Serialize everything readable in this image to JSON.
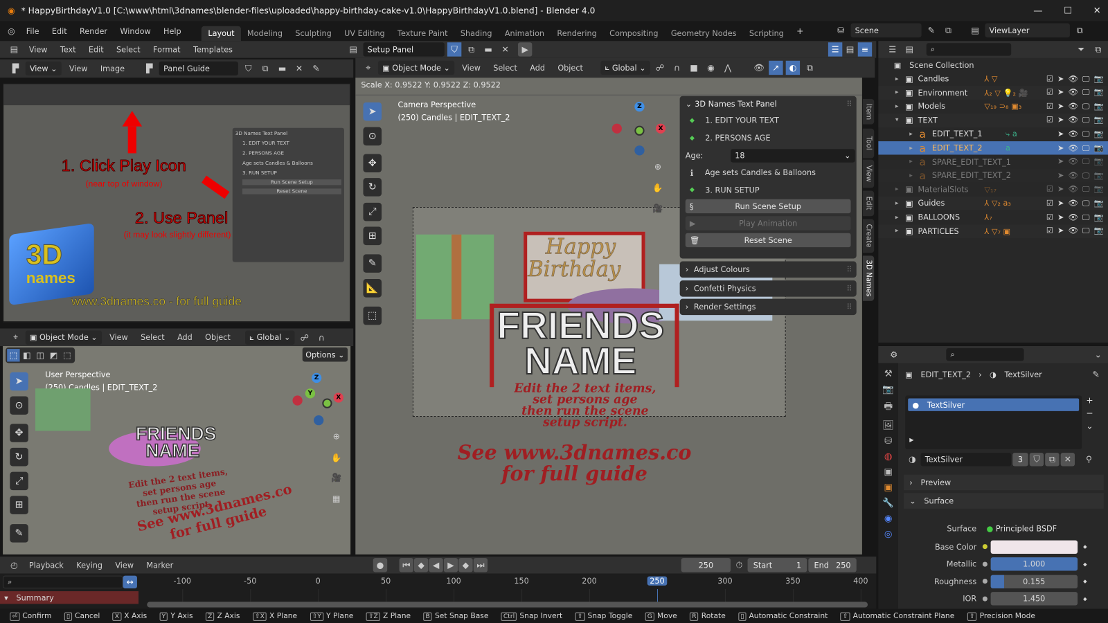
{
  "window": {
    "title": "* HappyBirthdayV1.0 [C:\\www\\html\\3dnames\\blender-files\\uploaded\\happy-birthday-cake-v1.0\\HappyBirthdayV1.0.blend] - Blender 4.0"
  },
  "menu": [
    "File",
    "Edit",
    "Render",
    "Window",
    "Help"
  ],
  "workspaces": [
    {
      "label": "Layout",
      "active": true
    },
    {
      "label": "Modeling"
    },
    {
      "label": "Sculpting"
    },
    {
      "label": "UV Editing"
    },
    {
      "label": "Texture Paint"
    },
    {
      "label": "Shading"
    },
    {
      "label": "Animation"
    },
    {
      "label": "Rendering"
    },
    {
      "label": "Compositing"
    },
    {
      "label": "Geometry Nodes"
    },
    {
      "label": "Scripting"
    }
  ],
  "scene": {
    "name": "Scene",
    "view_layer": "ViewLayer"
  },
  "text_editor": {
    "menus": [
      "View",
      "Text",
      "Edit",
      "Select",
      "Format",
      "Templates"
    ],
    "text_name": "Setup Panel"
  },
  "image_editor": {
    "view_dropdown": "View",
    "menus": [
      "View",
      "Image"
    ],
    "image_name": "Panel Guide"
  },
  "guide": {
    "step1": "1. Click Play Icon",
    "step1_sub": "(near top of window)",
    "step2": "2. Use Panel",
    "step2_sub": "(it may look slightly different)",
    "footer": "www.3dnames.co - for full guide",
    "logo": "3D names"
  },
  "viewport": {
    "mode": "Object Mode",
    "menus": [
      "View",
      "Select",
      "Add",
      "Object"
    ],
    "orientation": "Global",
    "status": "Scale X: 0.9522   Y: 0.9522   Z: 0.9522",
    "perspective": "Camera Perspective",
    "info": "(250) Candles | EDIT_TEXT_2",
    "scene_text": {
      "happy": "Happy",
      "birthday": "Birthday",
      "friends": "FRIENDS",
      "name": "NAME",
      "instructions": [
        "Edit the 2 text items,",
        "set persons age",
        "then run the scene",
        "setup script."
      ],
      "guide": [
        "See www.3dnames.co",
        "for full guide"
      ]
    }
  },
  "sidebar_tabs": [
    "Item",
    "Tool",
    "View",
    "Edit",
    "Create",
    "3D Names"
  ],
  "names_panel": {
    "title": "3D Names Text Panel",
    "step1": "1. EDIT YOUR TEXT",
    "step2": "2. PERSONS AGE",
    "age_label": "Age:",
    "age_value": "18",
    "info": "Age sets Candles & Balloons",
    "step3": "3. RUN SETUP",
    "run": "Run Scene Setup",
    "play": "Play Animation",
    "reset": "Reset Scene",
    "subpanels": [
      "Adjust Colours",
      "Confetti Physics",
      "Render Settings"
    ]
  },
  "viewport2": {
    "mode": "Object Mode",
    "menus": [
      "View",
      "Select",
      "Add",
      "Object"
    ],
    "orientation": "Global",
    "options": "Options",
    "perspective": "User Perspective",
    "info": "(250) Candles | EDIT_TEXT_2"
  },
  "outliner": {
    "root": "Scene Collection",
    "items": [
      {
        "name": "Candles",
        "depth": 0,
        "icons": "⅄ ▽",
        "exp": "▸",
        "check": true
      },
      {
        "name": "Environment",
        "depth": 0,
        "icons": "⅄₂ ▽ 💡₂ 🎥",
        "exp": "▸",
        "check": true
      },
      {
        "name": "Models",
        "depth": 0,
        "icons": "▽₁₉ ⊃₈ ▣₃",
        "exp": "▸",
        "check": true
      },
      {
        "name": "TEXT",
        "depth": 0,
        "icons": "",
        "exp": "▾",
        "check": true
      },
      {
        "name": "EDIT_TEXT_1",
        "depth": 1,
        "icons": "⤷ a",
        "exp": "▸",
        "check": false
      },
      {
        "name": "EDIT_TEXT_2",
        "depth": 1,
        "icons": "a",
        "exp": "▸",
        "check": false,
        "selected": true
      },
      {
        "name": "SPARE_EDIT_TEXT_1",
        "depth": 1,
        "icons": "",
        "exp": "▸",
        "check": false,
        "dim": true
      },
      {
        "name": "SPARE_EDIT_TEXT_2",
        "depth": 1,
        "icons": "",
        "exp": "▸",
        "check": false,
        "dim": true
      },
      {
        "name": "MaterialSlots",
        "depth": 0,
        "icons": "▽₁₇",
        "exp": "▸",
        "check": true,
        "dim": true
      },
      {
        "name": "Guides",
        "depth": 0,
        "icons": "⅄ ▽₂ a₃",
        "exp": "▸",
        "check": true
      },
      {
        "name": "BALLOONS",
        "depth": 0,
        "icons": "⅄₇",
        "exp": "▸",
        "check": true
      },
      {
        "name": "PARTICLES",
        "depth": 0,
        "icons": "⅄ ▽₇ ▣",
        "exp": "▸",
        "check": true
      }
    ]
  },
  "properties": {
    "object": "EDIT_TEXT_2",
    "material": "TextSilver",
    "slot": "TextSilver",
    "users": "3",
    "preview": "Preview",
    "surface_panel": "Surface",
    "surface_label": "Surface",
    "surface_value": "Principled BSDF",
    "fields": [
      {
        "label": "Base Color",
        "value": "",
        "color": "#f0e6ea"
      },
      {
        "label": "Metallic",
        "value": "1.000",
        "fill": 1.0
      },
      {
        "label": "Roughness",
        "value": "0.155",
        "fill": 0.155
      },
      {
        "label": "IOR",
        "value": "1.450",
        "fill": 0
      }
    ]
  },
  "timeline": {
    "menus": [
      "Playback",
      "Keying",
      "View",
      "Marker"
    ],
    "current_frame": "250",
    "start_label": "Start",
    "start": "1",
    "end_label": "End",
    "end": "250",
    "ticks": [
      "-100",
      "-50",
      "0",
      "50",
      "100",
      "150",
      "200",
      "250",
      "300",
      "350",
      "400"
    ],
    "summary": "Summary"
  },
  "statusbar": [
    {
      "k": "⏎",
      "t": "Confirm"
    },
    {
      "k": "▯",
      "t": "Cancel"
    },
    {
      "k": "X",
      "t": "X Axis"
    },
    {
      "k": "Y",
      "t": "Y Axis"
    },
    {
      "k": "Z",
      "t": "Z Axis"
    },
    {
      "k": "⇧X",
      "t": "X Plane"
    },
    {
      "k": "⇧Y",
      "t": "Y Plane"
    },
    {
      "k": "⇧Z",
      "t": "Z Plane"
    },
    {
      "k": "B",
      "t": "Set Snap Base"
    },
    {
      "k": "Ctrl",
      "t": "Snap Invert"
    },
    {
      "k": "⇧",
      "t": "Snap Toggle"
    },
    {
      "k": "G",
      "t": "Move"
    },
    {
      "k": "R",
      "t": "Rotate"
    },
    {
      "k": "▯",
      "t": "Automatic Constraint"
    },
    {
      "k": "⇧",
      "t": "Automatic Constraint Plane"
    },
    {
      "k": "⇧",
      "t": "Precision Mode"
    }
  ],
  "colors": {
    "accent": "#4772b3",
    "header": "#303030",
    "panel": "#2b2b2b",
    "outliner_icon": "#e08a30",
    "scene_bg": "#77776f",
    "red_text": "#a01e22"
  }
}
